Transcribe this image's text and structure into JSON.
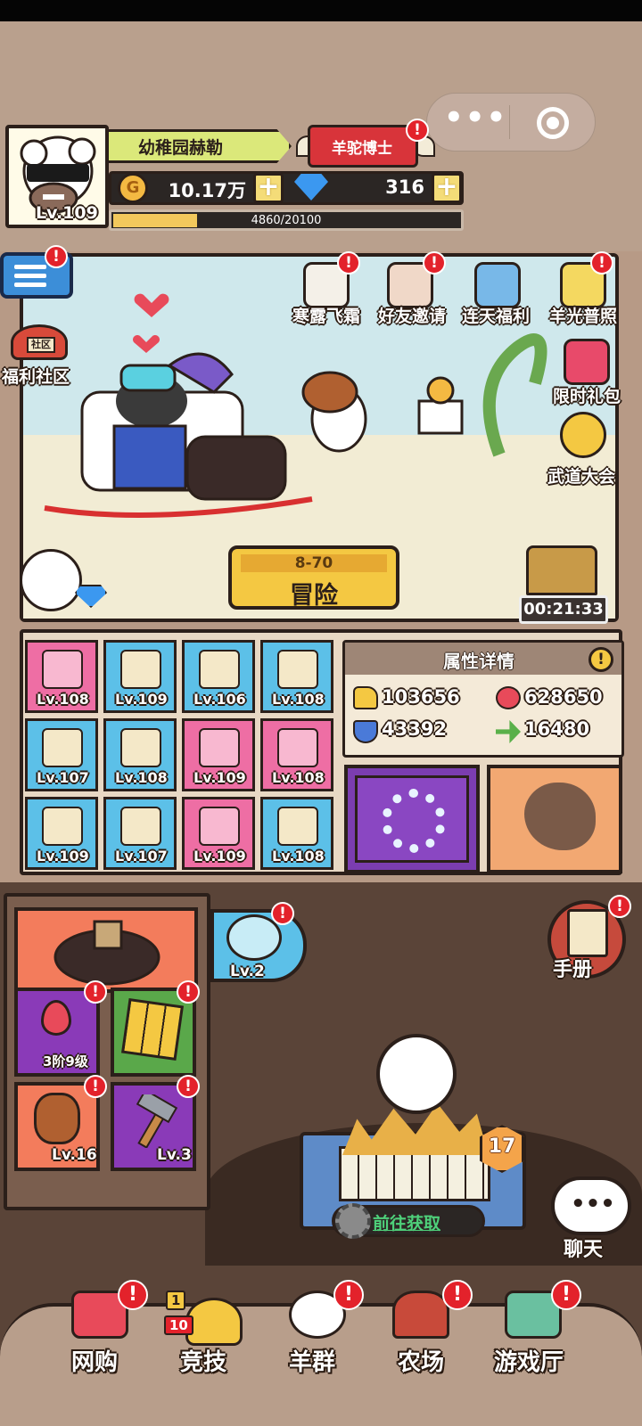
{
  "header": {
    "player_name": "幼稚园赫勒",
    "title": "羊驼博士",
    "avatar_level": "Lv.109",
    "coin": {
      "icon": "G",
      "value": "10.17万"
    },
    "gems": "316",
    "exp_text": "4860/20100",
    "exp_progress": 0.2418
  },
  "scene": {
    "side_links": [
      {
        "label": "福利社区",
        "sign": "社区"
      }
    ],
    "top_events": [
      {
        "label": "寒露飞霜"
      },
      {
        "label": "好友邀请"
      },
      {
        "label": "连天福利"
      },
      {
        "label": "羊光普照"
      }
    ],
    "right_events": [
      {
        "label": "限时礼包"
      },
      {
        "label": "武道大会"
      }
    ],
    "adventure": {
      "stage": "8-70",
      "label": "冒险"
    },
    "timer": "00:21:33"
  },
  "equipment": [
    {
      "level": "Lv.108",
      "color": "pink"
    },
    {
      "level": "Lv.109",
      "color": "blue"
    },
    {
      "level": "Lv.106",
      "color": "blue"
    },
    {
      "level": "Lv.108",
      "color": "blue"
    },
    {
      "level": "Lv.107",
      "color": "blue"
    },
    {
      "level": "Lv.108",
      "color": "blue"
    },
    {
      "level": "Lv.109",
      "color": "pink"
    },
    {
      "level": "Lv.108",
      "color": "pink"
    },
    {
      "level": "Lv.109",
      "color": "blue"
    },
    {
      "level": "Lv.107",
      "color": "blue"
    },
    {
      "level": "Lv.109",
      "color": "pink"
    },
    {
      "level": "Lv.108",
      "color": "blue"
    }
  ],
  "attributes": {
    "title": "属性详情",
    "info_icon": "!",
    "attack": "103656",
    "hp": "628650",
    "defense": "43392",
    "speed": "16480"
  },
  "side_panel": {
    "cards": [
      {
        "label": "3阶9级"
      },
      {
        "label": ""
      },
      {
        "label": "Lv.16"
      },
      {
        "label": "Lv.3"
      }
    ]
  },
  "fishbowl": {
    "level": "Lv.2"
  },
  "handbook": {
    "label": "手册"
  },
  "pen": {
    "level": "17",
    "goto_label": "前往获取"
  },
  "chat": {
    "label": "聊天",
    "dots": "•••"
  },
  "badge_text": "!",
  "bottom_nav": [
    {
      "label": "网购"
    },
    {
      "label": "竞技",
      "ranks": [
        "1",
        "10"
      ]
    },
    {
      "label": "羊群"
    },
    {
      "label": "农场"
    },
    {
      "label": "游戏厅"
    }
  ],
  "colors": {
    "accent_red": "#e3222b",
    "gold": "#f4c842",
    "blue_slot": "#5cc0e8",
    "pink_slot": "#ee6ea4",
    "outline": "#2b1f1a"
  }
}
